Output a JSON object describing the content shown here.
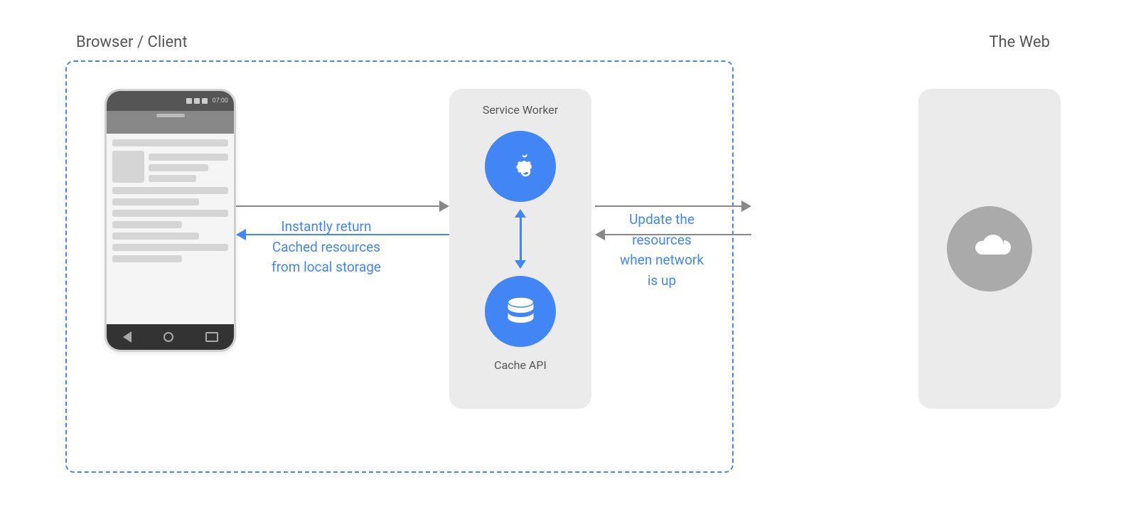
{
  "diagram": {
    "browser_client_label": "Browser / Client",
    "the_web_label": "The Web",
    "service_worker_label": "Service Worker",
    "cache_api_label": "Cache API",
    "arrow_cached_line1": "Instantly return",
    "arrow_cached_line2": "Cached resources",
    "arrow_cached_line3": "from local storage",
    "arrow_update_line1": "Update the",
    "arrow_update_line2": "resources",
    "arrow_update_line3": "when network",
    "arrow_update_line4": "is up",
    "phone_time": "07:00"
  }
}
